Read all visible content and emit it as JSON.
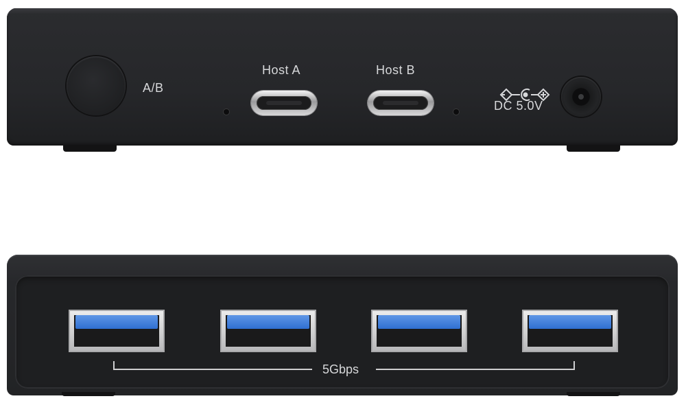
{
  "back_panel": {
    "switch_label": "A/B",
    "port_a_label": "Host A",
    "port_b_label": "Host B",
    "power_label": "DC 5.0V"
  },
  "front_panel": {
    "speed_label": "5Gbps",
    "usb_port_count": 4
  },
  "colors": {
    "body": "#26272a",
    "usb_tongue": "#3f7fdc",
    "label_text": "#d7d8da"
  }
}
